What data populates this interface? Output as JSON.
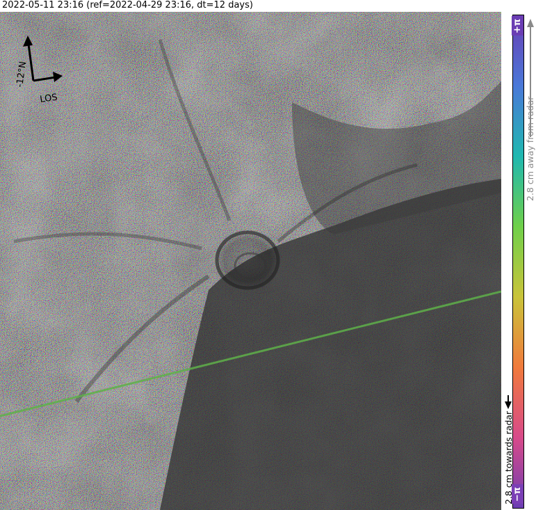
{
  "title": "2022-05-11 23:16 (ref=2022-04-29 23:16, dt=12 days)",
  "north_arrow": {
    "north_label": "-12°N",
    "los_label": "LOS"
  },
  "colorbar": {
    "top_label": "+π",
    "bottom_label": "−π",
    "away_label": "2.8 cm away from radar",
    "towards_label": "2.8 cm towards radar"
  },
  "colors": {
    "cbar_purple": "#6a3db3",
    "cbar_blue": "#4a78d8",
    "cbar_cyan": "#1fb8b0",
    "cbar_green": "#6fd04a",
    "cbar_yellow": "#c9c43a",
    "cbar_orange": "#f07a3c",
    "cbar_pink": "#d84a8a",
    "track_line": "#5fb04a"
  }
}
